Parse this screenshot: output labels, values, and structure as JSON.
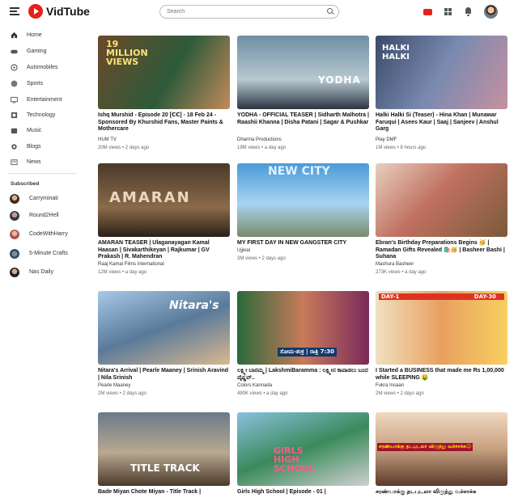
{
  "app": {
    "name": "VidTube"
  },
  "search": {
    "placeholder": "Search"
  },
  "colors": {
    "brand": "#e62117",
    "text": "#0f0f0f",
    "secondary": "#606060"
  },
  "nav": [
    {
      "label": "Home",
      "icon": "home-icon"
    },
    {
      "label": "Gaming",
      "icon": "gamepad-icon"
    },
    {
      "label": "Automobiles",
      "icon": "car-icon"
    },
    {
      "label": "Sports",
      "icon": "ball-icon"
    },
    {
      "label": "Entertainment",
      "icon": "tv-icon"
    },
    {
      "label": "Technology",
      "icon": "chip-icon"
    },
    {
      "label": "Music",
      "icon": "music-icon"
    },
    {
      "label": "Blogs",
      "icon": "blog-icon"
    },
    {
      "label": "News",
      "icon": "news-icon"
    }
  ],
  "subscribed": {
    "title": "Subscribed",
    "channels": [
      {
        "name": "Carryminati"
      },
      {
        "name": "Round2Hell"
      },
      {
        "name": "CodeWithHarry"
      },
      {
        "name": "5-Minute Crafts"
      },
      {
        "name": "Nas Daily"
      }
    ]
  },
  "videos": [
    {
      "title": "Ishq Murshid - Episode 20 [𝗖𝗖] - 18 Feb 24 - Sponsored By Khurshid Fans, Master Paints & Mothercare",
      "channel": "HUM TV",
      "views": "20M views",
      "age": "2 days ago",
      "thumb_text": "19 MILLION VIEWS"
    },
    {
      "title": "YODHA - OFFICIAL TEASER | Sidharth Malhotra | Raashii Khanna | Disha Patani | Sagar & Pushkar",
      "channel": "Dharma Productions",
      "views": "19M views",
      "age": "a day ago",
      "thumb_text": "YODHA"
    },
    {
      "title": "Halki Halki Si (Teaser) - Hina Khan | Munawar Faruqui | Asees Kaur | Saaj | Sanjeev | Anshul Garg",
      "channel": "Play DMF",
      "views": "1M views",
      "age": "8 hours ago",
      "thumb_text": "HALKI HALKI"
    },
    {
      "title": "AMARAN TEASER | Ulaganayagan Kamal Haasan | Sivakarthikeyan | Rajkumar | GV Prakash | R. Mahendran",
      "channel": "Raaj Kamal Films International",
      "views": "12M views",
      "age": "a day ago",
      "thumb_text": "AMARAN"
    },
    {
      "title": "MY FIRST DAY IN NEW GANGSTER CITY",
      "channel": "Ujjwal",
      "views": "3M views",
      "age": "2 days ago",
      "thumb_text": "NEW CITY"
    },
    {
      "title": "Ebran's Birthday Preparations Begins 🥳 | Ramadan Gifts Revealed 🛍️🥳 | Basheer Bashi | Suhana",
      "channel": "Mashura Basheer",
      "views": "273K views",
      "age": "a day ago",
      "thumb_text": ""
    },
    {
      "title": "Nitara's Arrival | Pearle Maaney | Srinish Aravind | Nila Srinish",
      "channel": "Pearle Maaney",
      "views": "2M views",
      "age": "2 days ago",
      "thumb_text": "Nitara's"
    },
    {
      "title": "ಲಕ್ಷ್ಮೀ ಬಾರಮ್ಮ | LakshmiBaramma : ಲಕ್ಷ್ಮೀನ ಕಾಪಾಡಲು ಬಂದ ವೈಷ್ಣವ್..",
      "channel": "Colors Kannada",
      "views": "490K views",
      "age": "a day ago",
      "thumb_text": "ಸೋಮ-ಶುಕ್ರ | ರಾತ್ರಿ 7:30"
    },
    {
      "title": "I Started a BUSINESS that made me Rs 1,00,000 while SLEEPING 🤑",
      "channel": "Fukra Insaan",
      "views": "2M views",
      "age": "2 days ago",
      "thumb_text": "DAY-1 DAY-30"
    },
    {
      "title": "Bade Miyan Chote Miyan - Title Track | ",
      "channel": "",
      "views": "",
      "age": "",
      "thumb_text": "TITLE TRACK"
    },
    {
      "title": "Girls High School | Episode - 01 | ",
      "channel": "",
      "views": "",
      "age": "",
      "thumb_text": "GIRLS HIGH SCHOOL"
    },
    {
      "title": "சரண்யாக்கு தடபுடலா விருந்து வச்சாச்சு ",
      "channel": "",
      "views": "",
      "age": "",
      "thumb_text": "சரண்யாக்கு தடபுடலா விருந்து வச்சாச்சு😊"
    }
  ]
}
